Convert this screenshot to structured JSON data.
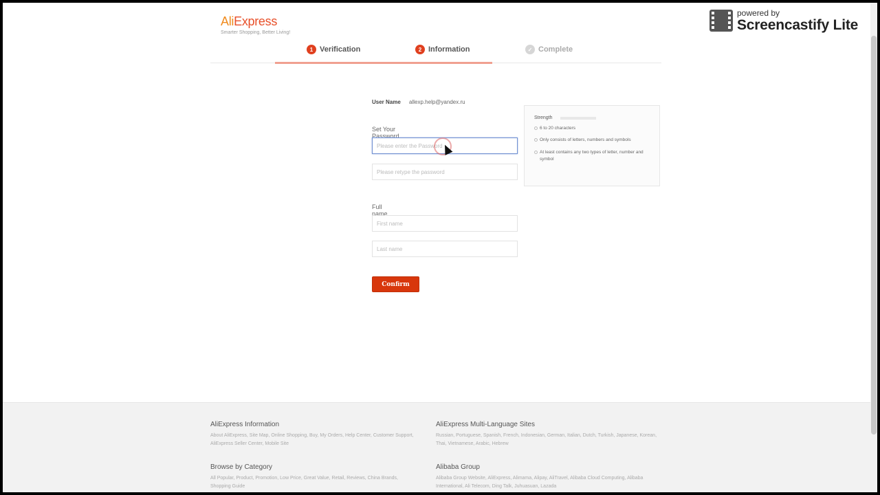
{
  "logo": {
    "brand_part1": "Ali",
    "brand_part2": "Express",
    "tagline": "Smarter Shopping, Better Living!"
  },
  "steps": [
    {
      "num": "1",
      "label": "Verification"
    },
    {
      "num": "2",
      "label": "Information"
    },
    {
      "num": "✓",
      "label": "Complete"
    }
  ],
  "form": {
    "user_name_label": "User Name",
    "user_name_value": "allexp.help@yandex.ru",
    "password_label": "Set Your Password",
    "password_placeholder": "Please enter the Password",
    "retype_placeholder": "Please retype the password",
    "fullname_label": "Full name",
    "first_name_placeholder": "First name",
    "last_name_placeholder": "Last name",
    "confirm_button": "Confirm"
  },
  "strength_panel": {
    "title": "Strength",
    "rules": [
      "6 to 20 characters",
      "Only consists of letters, numbers and symbols",
      "At least contains any two types of letter, number and symbol"
    ]
  },
  "footer": {
    "col1": [
      {
        "title": "AliExpress Information",
        "links": "About AliExpress, Site Map, Online Shopping, Buy, My Orders, Help Center, Customer Support, AliExpress Seller Center, Mobile Site"
      },
      {
        "title": "Browse by Category",
        "links": "All Popular, Product, Promotion, Low Price, Great Value, Retail, Reviews, China Brands, Shopping Guide"
      }
    ],
    "col2": [
      {
        "title": "AliExpress Multi-Language Sites",
        "links": "Russian, Portuguese, Spanish, French, Indonesian, German, Italian, Dutch, Turkish, Japanese, Korean, Thai, Vietnamese, Arabic, Hebrew"
      },
      {
        "title": "Alibaba Group",
        "links": "Alibaba Group Website, AliExpress, Alimama, Alipay, AliTravel, Alibaba Cloud Computing, Alibaba International, Ali Telecom, Ding Talk, Juhuasuan, Lazada"
      }
    ]
  },
  "watermark": {
    "line1": "powered by",
    "line2": "Screencastify Lite"
  }
}
